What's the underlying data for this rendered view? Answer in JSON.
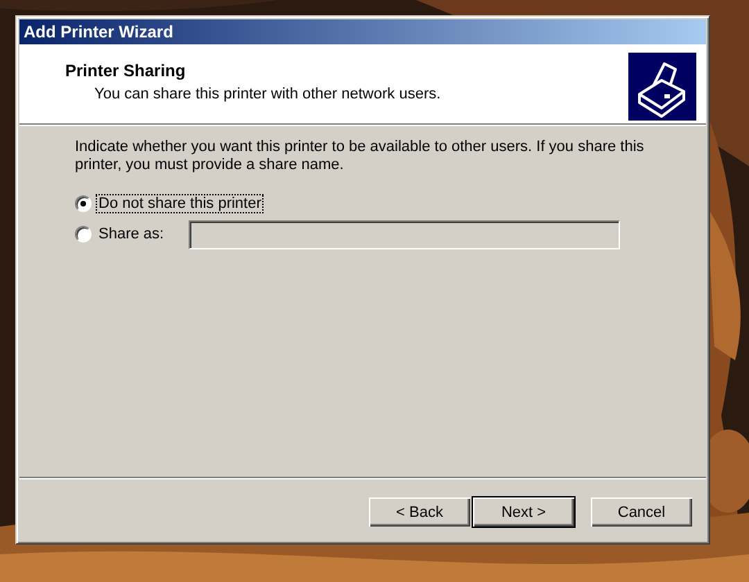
{
  "window": {
    "title": "Add Printer Wizard"
  },
  "header": {
    "title": "Printer Sharing",
    "subtitle": "You can share this printer with other network users."
  },
  "instructions": "Indicate whether you want this printer to be available to other users. If you share this printer, you must provide a share name.",
  "options": [
    {
      "label": "Do not share this printer",
      "selected": true,
      "focused": true
    },
    {
      "label": "Share as:",
      "selected": false,
      "focused": false
    }
  ],
  "share_name_field": {
    "disabled": true
  },
  "buttons": [
    {
      "label": "< Back",
      "default": false
    },
    {
      "label": "Next >",
      "default": true
    },
    {
      "label": "Cancel",
      "default": false
    }
  ]
}
